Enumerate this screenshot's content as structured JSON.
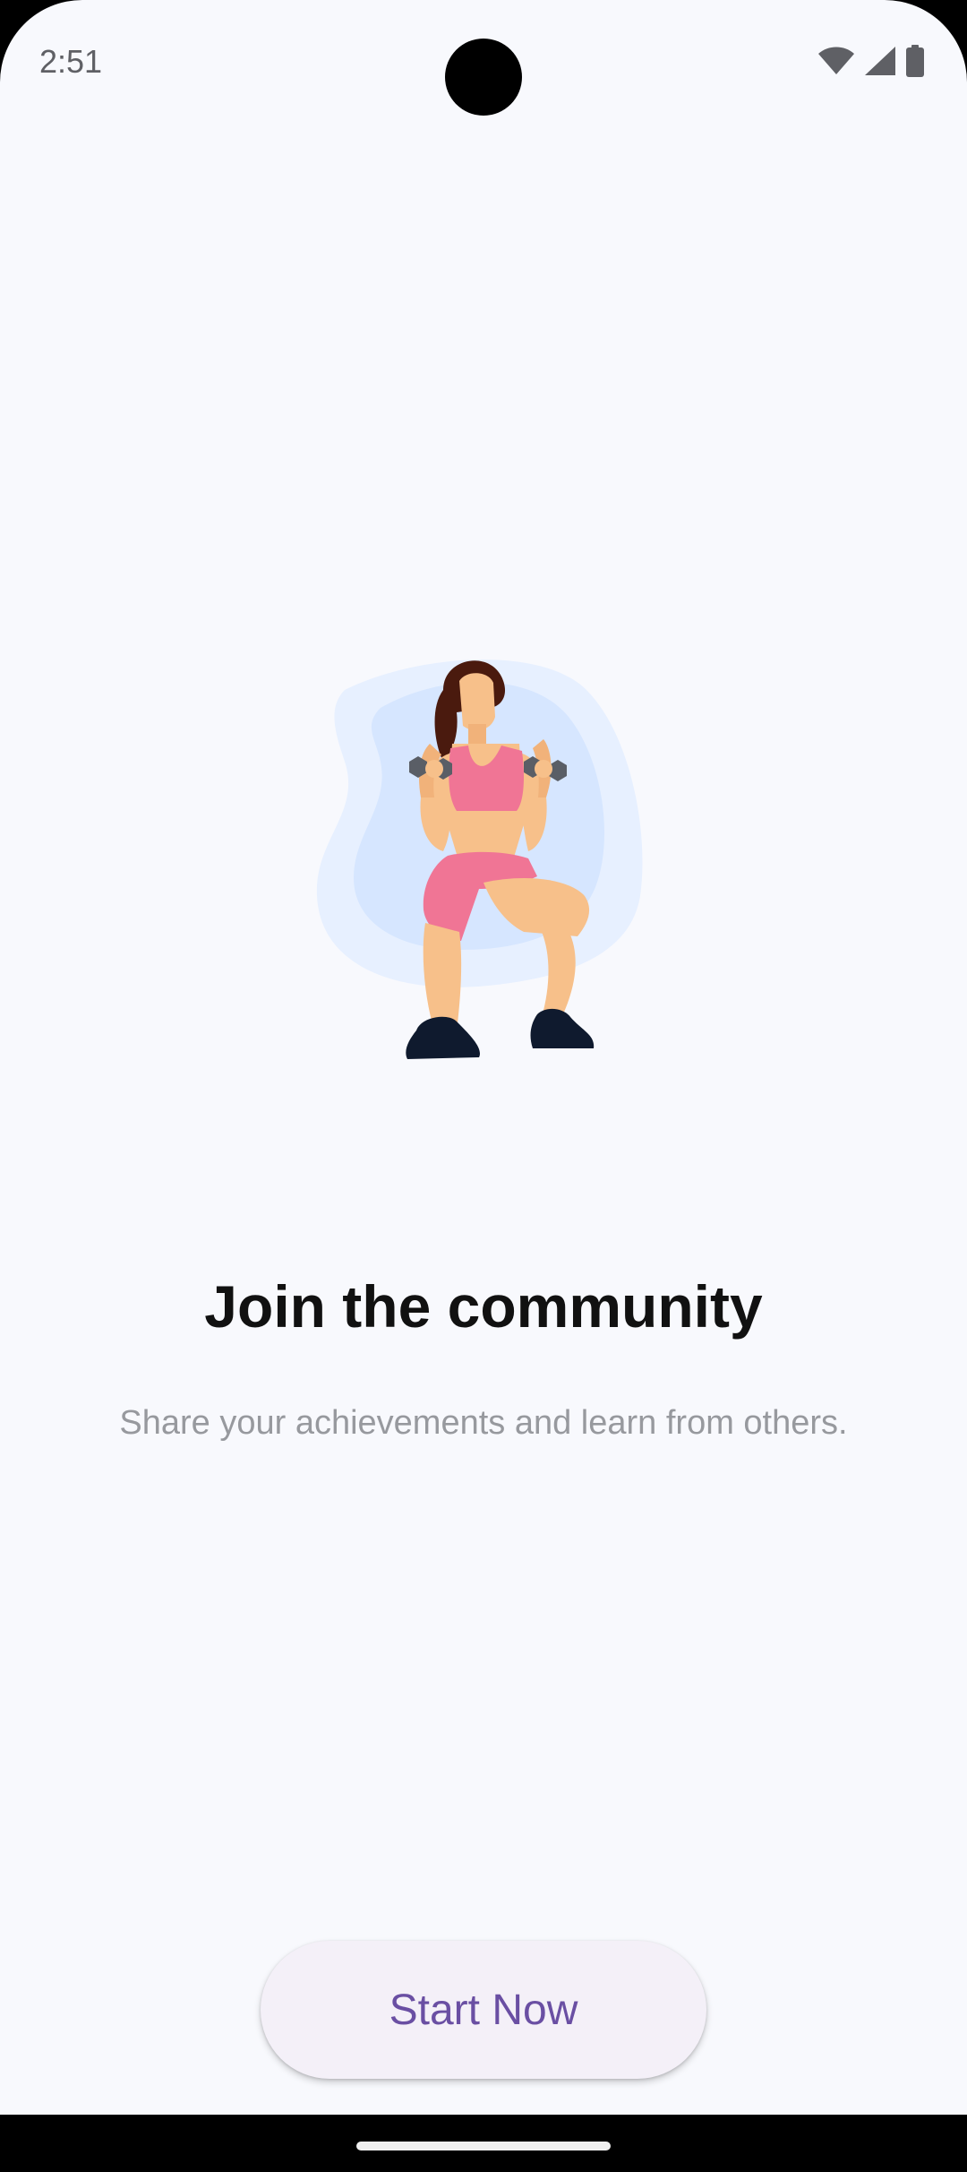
{
  "status_bar": {
    "time": "2:51",
    "icons": [
      "wifi-icon",
      "cellular-signal-icon",
      "battery-icon"
    ]
  },
  "onboarding": {
    "illustration": "woman-lifting-dumbbells-illustration",
    "title": "Join the community",
    "subtitle": "Share your achievements and learn from others."
  },
  "actions": {
    "start_label": "Start Now"
  },
  "colors": {
    "background": "#f8f9fd",
    "title": "#111111",
    "subtitle": "#97999e",
    "button_bg": "#f4f0f8",
    "button_text": "#6a4fa3"
  }
}
